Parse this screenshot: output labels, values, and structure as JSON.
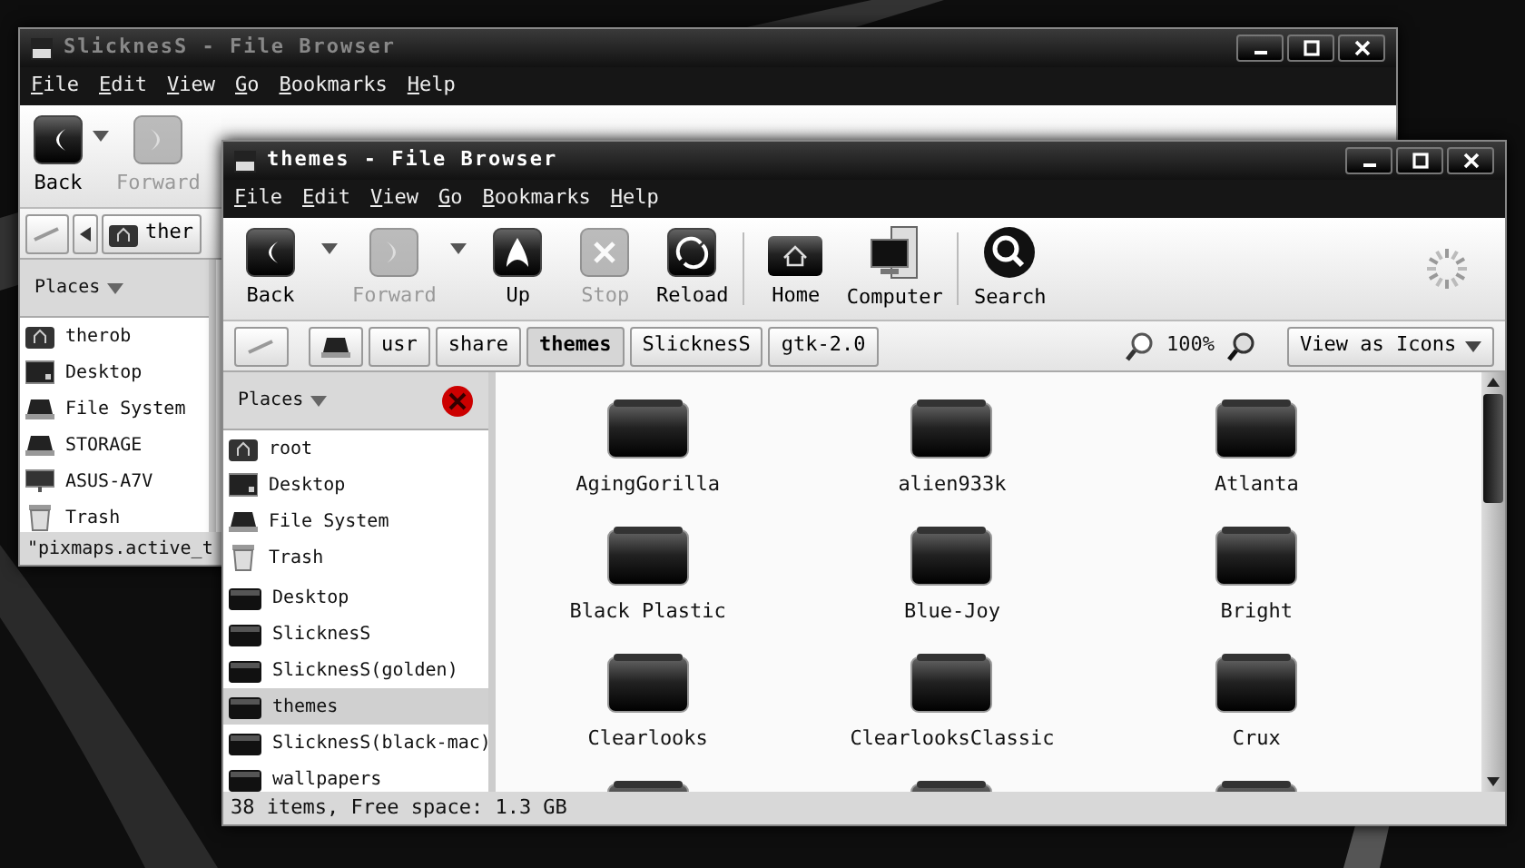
{
  "back_window": {
    "title": "SlicknesS - File Browser",
    "active": false,
    "window_buttons": [
      {
        "kind": "minimize"
      },
      {
        "kind": "maximize"
      },
      {
        "kind": "close"
      }
    ],
    "menu": [
      "File",
      "Edit",
      "View",
      "Go",
      "Bookmarks",
      "Help"
    ],
    "toolbar": [
      {
        "kind": "back",
        "label": "Back",
        "disabled": false,
        "dropdown": true
      },
      {
        "kind": "forward",
        "label": "Forward",
        "disabled": true,
        "dropdown": false
      }
    ],
    "path_bar": [
      {
        "kind": "toggle"
      },
      {
        "kind": "scroll-left"
      },
      {
        "kind": "home-crumb",
        "label": "ther",
        "selected": false
      }
    ],
    "sidebar": {
      "title": "Places",
      "closable": false,
      "items": [
        {
          "kind": "home",
          "label": "therob",
          "selected": false
        },
        {
          "kind": "desktop",
          "label": "Desktop",
          "selected": false
        },
        {
          "kind": "drive",
          "label": "File System",
          "selected": false
        },
        {
          "kind": "drive",
          "label": "STORAGE",
          "selected": false
        },
        {
          "kind": "network",
          "label": "ASUS-A7V",
          "selected": false
        },
        {
          "kind": "trash",
          "label": "Trash",
          "selected": false
        }
      ]
    },
    "status_bar": "\"pixmaps.active_t"
  },
  "front_window": {
    "title": "themes - File Browser",
    "active": true,
    "window_buttons": [
      {
        "kind": "minimize"
      },
      {
        "kind": "maximize"
      },
      {
        "kind": "close"
      }
    ],
    "menu": [
      "File",
      "Edit",
      "View",
      "Go",
      "Bookmarks",
      "Help"
    ],
    "toolbar": [
      {
        "kind": "back",
        "label": "Back",
        "disabled": false,
        "dropdown": true
      },
      {
        "kind": "forward",
        "label": "Forward",
        "disabled": true,
        "dropdown": true
      },
      {
        "kind": "up",
        "label": "Up",
        "disabled": false,
        "dropdown": false
      },
      {
        "kind": "stop",
        "label": "Stop",
        "disabled": true,
        "dropdown": false
      },
      {
        "kind": "reload",
        "label": "Reload",
        "disabled": false,
        "dropdown": false
      },
      {
        "kind": "separator"
      },
      {
        "kind": "home",
        "label": "Home",
        "disabled": false,
        "dropdown": false
      },
      {
        "kind": "computer",
        "label": "Computer",
        "disabled": false,
        "dropdown": false
      },
      {
        "kind": "separator"
      },
      {
        "kind": "search",
        "label": "Search",
        "disabled": false,
        "dropdown": false
      },
      {
        "kind": "spinner"
      }
    ],
    "path_bar": [
      {
        "kind": "toggle"
      },
      {
        "kind": "drive"
      },
      {
        "kind": "crumb",
        "label": "usr",
        "selected": false
      },
      {
        "kind": "crumb",
        "label": "share",
        "selected": false
      },
      {
        "kind": "crumb",
        "label": "themes",
        "selected": true
      },
      {
        "kind": "crumb",
        "label": "SlicknesS",
        "selected": false
      },
      {
        "kind": "crumb",
        "label": "gtk-2.0",
        "selected": false
      }
    ],
    "zoom": "100%",
    "view_mode": "View as Icons",
    "sidebar": {
      "title": "Places",
      "closable": true,
      "items": [
        {
          "kind": "home",
          "label": "root",
          "selected": false
        },
        {
          "kind": "desktop",
          "label": "Desktop",
          "selected": false
        },
        {
          "kind": "drive",
          "label": "File System",
          "selected": false
        },
        {
          "kind": "trash",
          "label": "Trash",
          "selected": false
        },
        {
          "kind": "bookmark",
          "label": "Desktop",
          "selected": false
        },
        {
          "kind": "bookmark",
          "label": "SlicknesS",
          "selected": false
        },
        {
          "kind": "bookmark",
          "label": "SlicknesS(golden)",
          "selected": false
        },
        {
          "kind": "bookmark",
          "label": "themes",
          "selected": true
        },
        {
          "kind": "bookmark",
          "label": "SlicknesS(black-mac)",
          "selected": false
        },
        {
          "kind": "bookmark",
          "label": "wallpapers",
          "selected": false
        }
      ]
    },
    "files": [
      {
        "kind": "folder",
        "label": "AgingGorilla"
      },
      {
        "kind": "folder",
        "label": "alien933k"
      },
      {
        "kind": "folder",
        "label": "Atlanta"
      },
      {
        "kind": "folder",
        "label": "Black Plastic"
      },
      {
        "kind": "folder",
        "label": "Blue-Joy"
      },
      {
        "kind": "folder",
        "label": "Bright"
      },
      {
        "kind": "folder",
        "label": "Clearlooks"
      },
      {
        "kind": "folder",
        "label": "ClearlooksClassic"
      },
      {
        "kind": "folder",
        "label": "Crux"
      },
      {
        "kind": "folder"
      },
      {
        "kind": "folder"
      },
      {
        "kind": "folder"
      }
    ],
    "status_bar": "38 items, Free space: 1.3 GB"
  }
}
